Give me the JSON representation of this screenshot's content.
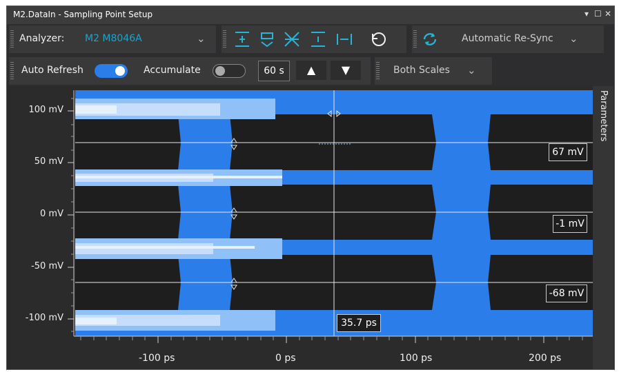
{
  "window": {
    "title": "M2.DataIn - Sampling Point Setup",
    "controls": [
      "▾",
      "☐",
      "✕"
    ]
  },
  "toolbar1": {
    "analyzer_label": "Analyzer:",
    "analyzer_value": "M2 M8046A",
    "resync_label": "Automatic  Re-Sync",
    "dropdown_glyph": "⌄"
  },
  "toolbar2": {
    "auto_refresh_label": "Auto Refresh",
    "auto_refresh_on": true,
    "accumulate_label": "Accumulate",
    "accumulate_on": false,
    "interval": "60 s",
    "up_glyph": "▲",
    "down_glyph": "▼",
    "scales_value": "Both Scales"
  },
  "side_panel": {
    "label": "Parameters"
  },
  "plot": {
    "y_ticks": [
      "100 mV",
      "50 mV",
      "0 mV",
      "-50 mV",
      "-100 mV"
    ],
    "x_ticks": [
      "-100 ps",
      "0 ps",
      "100 ps",
      "200 ps"
    ],
    "thresholds": [
      "67 mV",
      "-1 mV",
      "-68 mV"
    ],
    "cursor_label": "35.7 ps"
  },
  "colors": {
    "signal": "#2b7de9",
    "eye": "#1e1e1e",
    "light": "#8fc0f8",
    "lightest": "#e6f1ff"
  }
}
